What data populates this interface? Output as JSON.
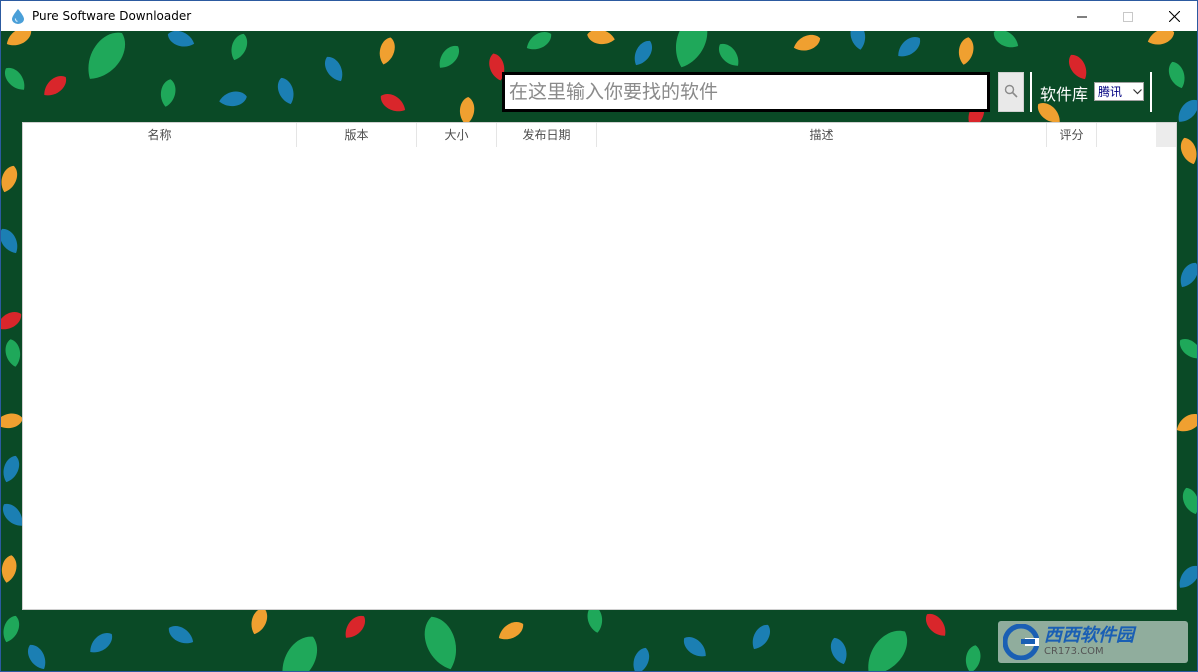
{
  "window": {
    "title": "Pure Software Downloader",
    "icon": "water-drop-icon"
  },
  "window_controls": {
    "minimize_icon": "minimize-icon",
    "maximize_icon": "maximize-icon",
    "close_icon": "close-icon"
  },
  "search": {
    "placeholder": "在这里输入你要找的软件",
    "value": "",
    "button_icon": "search-icon"
  },
  "library": {
    "label": "软件库",
    "selected": "腾讯"
  },
  "table": {
    "columns": [
      "名称",
      "版本",
      "大小",
      "发布日期",
      "描述",
      "评分"
    ],
    "rows": []
  },
  "watermark": {
    "name": "西西软件园",
    "domain": "CR173.COM"
  },
  "colors": {
    "background": "#0a4a26",
    "leaf_green": "#1fa85a",
    "leaf_blue": "#1b7fb3",
    "leaf_orange": "#f0a030",
    "leaf_red": "#d9262b"
  }
}
